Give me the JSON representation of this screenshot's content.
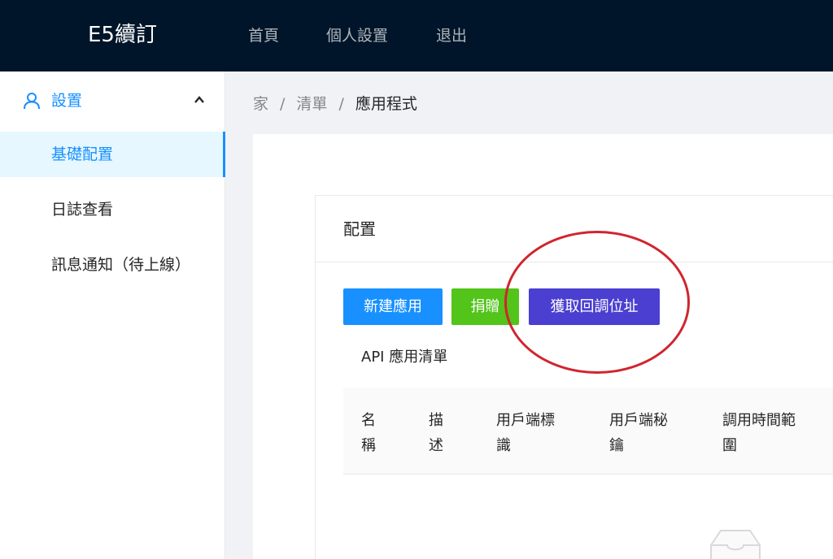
{
  "header": {
    "logo": "E5續訂",
    "nav": [
      "首頁",
      "個人設置",
      "退出"
    ]
  },
  "sidebar": {
    "submenu_label": "設置",
    "submenu_icon": "user-icon",
    "caret_icon": "chevron-up-icon",
    "items": [
      {
        "label": "基礎配置",
        "selected": true
      },
      {
        "label": "日誌查看",
        "selected": false
      },
      {
        "label": "訊息通知（待上線）",
        "selected": false
      }
    ]
  },
  "breadcrumb": {
    "items": [
      "家",
      "清單",
      "應用程式"
    ],
    "separator": "/"
  },
  "card": {
    "title": "配置",
    "buttons": [
      {
        "label": "新建應用",
        "color": "#1890ff"
      },
      {
        "label": "捐贈",
        "color": "#52c41a"
      },
      {
        "label": "獲取回調位址",
        "color": "#4a3fd0"
      }
    ],
    "list_title": "API 應用清單",
    "table": {
      "columns": [
        "名\n稱",
        "描\n述",
        "用戶端標\n識",
        "用戶端秘\n鑰",
        "調用時間範\n圍"
      ],
      "empty_icon": "inbox-empty-icon"
    }
  },
  "colors": {
    "header_bg": "#001529",
    "primary": "#1890ff",
    "success": "#52c41a",
    "purple": "#4a3fd0",
    "annotation": "#d0252f"
  }
}
